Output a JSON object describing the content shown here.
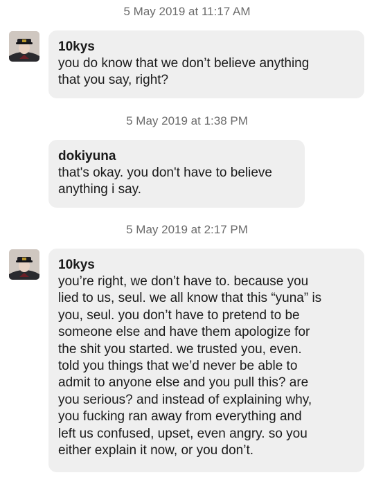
{
  "messages": [
    {
      "timestamp": "5 May 2019 at 11:17 AM",
      "username": "10kys",
      "text": "you do know that we don’t believe anything\nthat you say, right?",
      "has_avatar": true
    },
    {
      "timestamp": "5 May 2019 at 1:38 PM",
      "username": "dokiyuna",
      "text": "that's okay. you don't have to believe\nanything i say.",
      "has_avatar": false
    },
    {
      "timestamp": "5 May 2019 at 2:17 PM",
      "username": "10kys",
      "text": "you’re right, we don’t have to. because you\nlied to us, seul. we all know that this “yuna” is\nyou, seul. you don’t have to pretend to be\nsomeone else and have them apologize for\nthe shit you started. we trusted you, even.\ntold you things that we’d never be able to\nadmit to anyone else and you pull this? are\nyou serious? and instead of explaining why,\nyou fucking ran away from everything and\nleft us confused, upset, even angry. so you\neither explain it now, or you don’t.",
      "has_avatar": true
    }
  ],
  "colors": {
    "bubble_bg": "#efefef",
    "timestamp_text": "#6b6b6b",
    "message_text": "#1a1a1a"
  }
}
